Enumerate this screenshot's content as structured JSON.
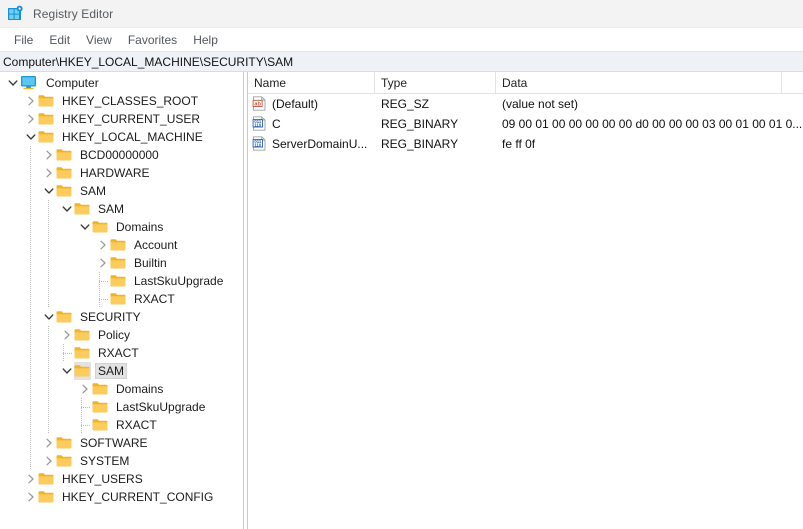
{
  "window": {
    "title": "Registry Editor",
    "icon": "registry-editor-icon"
  },
  "menubar": {
    "items": [
      {
        "label": "File"
      },
      {
        "label": "Edit"
      },
      {
        "label": "View"
      },
      {
        "label": "Favorites"
      },
      {
        "label": "Help"
      }
    ]
  },
  "address": {
    "path": "Computer\\HKEY_LOCAL_MACHINE\\SECURITY\\SAM"
  },
  "tree": {
    "nodes": [
      {
        "label": "Computer",
        "depth": 0,
        "state": "expanded",
        "icon": "computer-icon"
      },
      {
        "label": "HKEY_CLASSES_ROOT",
        "depth": 1,
        "state": "collapsed",
        "icon": "folder-icon"
      },
      {
        "label": "HKEY_CURRENT_USER",
        "depth": 1,
        "state": "collapsed",
        "icon": "folder-icon"
      },
      {
        "label": "HKEY_LOCAL_MACHINE",
        "depth": 1,
        "state": "expanded",
        "icon": "folder-icon"
      },
      {
        "label": "BCD00000000",
        "depth": 2,
        "state": "collapsed",
        "icon": "folder-icon"
      },
      {
        "label": "HARDWARE",
        "depth": 2,
        "state": "collapsed",
        "icon": "folder-icon"
      },
      {
        "label": "SAM",
        "depth": 2,
        "state": "expanded",
        "icon": "folder-icon"
      },
      {
        "label": "SAM",
        "depth": 3,
        "state": "expanded",
        "icon": "folder-icon"
      },
      {
        "label": "Domains",
        "depth": 4,
        "state": "expanded",
        "icon": "folder-icon"
      },
      {
        "label": "Account",
        "depth": 5,
        "state": "collapsed",
        "icon": "folder-icon"
      },
      {
        "label": "Builtin",
        "depth": 5,
        "state": "collapsed",
        "icon": "folder-icon"
      },
      {
        "label": "LastSkuUpgrade",
        "depth": 5,
        "state": "leaf",
        "icon": "folder-icon"
      },
      {
        "label": "RXACT",
        "depth": 5,
        "state": "leaf",
        "icon": "folder-icon"
      },
      {
        "label": "SECURITY",
        "depth": 2,
        "state": "expanded",
        "icon": "folder-icon"
      },
      {
        "label": "Policy",
        "depth": 3,
        "state": "collapsed",
        "icon": "folder-icon"
      },
      {
        "label": "RXACT",
        "depth": 3,
        "state": "leaf",
        "icon": "folder-icon"
      },
      {
        "label": "SAM",
        "depth": 3,
        "state": "expanded",
        "icon": "folder-icon",
        "selected": true
      },
      {
        "label": "Domains",
        "depth": 4,
        "state": "collapsed",
        "icon": "folder-icon"
      },
      {
        "label": "LastSkuUpgrade",
        "depth": 4,
        "state": "leaf",
        "icon": "folder-icon"
      },
      {
        "label": "RXACT",
        "depth": 4,
        "state": "leaf",
        "icon": "folder-icon"
      },
      {
        "label": "SOFTWARE",
        "depth": 2,
        "state": "collapsed",
        "icon": "folder-icon"
      },
      {
        "label": "SYSTEM",
        "depth": 2,
        "state": "collapsed",
        "icon": "folder-icon"
      },
      {
        "label": "HKEY_USERS",
        "depth": 1,
        "state": "collapsed",
        "icon": "folder-icon"
      },
      {
        "label": "HKEY_CURRENT_CONFIG",
        "depth": 1,
        "state": "collapsed",
        "icon": "folder-icon"
      }
    ]
  },
  "values": {
    "columns": [
      {
        "label": "Name"
      },
      {
        "label": "Type"
      },
      {
        "label": "Data"
      }
    ],
    "rows": [
      {
        "name": "(Default)",
        "type": "REG_SZ",
        "data": "(value not set)",
        "icon": "string-value-icon"
      },
      {
        "name": "C",
        "type": "REG_BINARY",
        "data": "09 00 01 00 00 00 00 00 d0 00 00 00 03 00 01 00 01 0...",
        "icon": "binary-value-icon"
      },
      {
        "name": "ServerDomainU...",
        "type": "REG_BINARY",
        "data": "fe ff 0f",
        "icon": "binary-value-icon"
      }
    ]
  },
  "colors": {
    "titlebar_bg": "#f3f3f3",
    "address_bg": "#eef2f7",
    "folder_gold": "#f7c760",
    "selection_gray": "#e2e2e2",
    "accent_blue": "#0d86d6"
  }
}
